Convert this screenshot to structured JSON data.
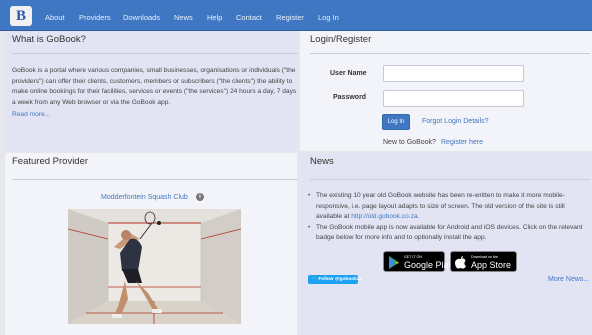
{
  "nav": {
    "logo_letter": "B",
    "links": [
      "About",
      "Providers",
      "Downloads",
      "News",
      "Help",
      "Contact",
      "Register",
      "Log In"
    ]
  },
  "about": {
    "title": "What is GoBook?",
    "text": "GoBook is a portal where various companies, small businesses, organisations or individuals (\"the providers\") can offer their clients, customers, members or subscribers (\"the clients\") the ability to make online bookings for their facilities, services or events (\"the services\") 24 hours a day, 7 days a week from any Web browser or via the GoBook app.",
    "read_more": "Read more..."
  },
  "login": {
    "title": "Login/Register",
    "username_label": "User Name",
    "username_value": "",
    "password_label": "Password",
    "password_value": "",
    "button_label": "Log In",
    "forgot_link": "Forgot Login Details?",
    "new_text": "New to GoBook?",
    "register_link": "Register here"
  },
  "featured": {
    "title": "Featured Provider",
    "provider_name": "Modderfontein Squash Club",
    "info_icon": "info-icon"
  },
  "news": {
    "title": "News",
    "item1_text": "The existing 10 year old GoBook website has been re-written to make it more mobile-responsive, i.e. page layout adapts to size of screen. The old version of the site is still available at",
    "item1_link": "http://old.gobook.co.za",
    "item1_end": ".",
    "item2_text": "The GoBook mobile app is now available for Android and iOS devices. Click on the relevant badge below for more info and to optionally install the app.",
    "google_small": "GET IT ON",
    "google_big": "Google Play",
    "apple_small": "Download on the",
    "apple_big": "App Store",
    "twitter_label": "Follow @gobookza",
    "more_news": "More News..."
  },
  "colors": {
    "navbar": "#3f77c2",
    "panel": "#e2e4f4",
    "link": "#3f77c2",
    "twitter": "#1da1f2"
  }
}
